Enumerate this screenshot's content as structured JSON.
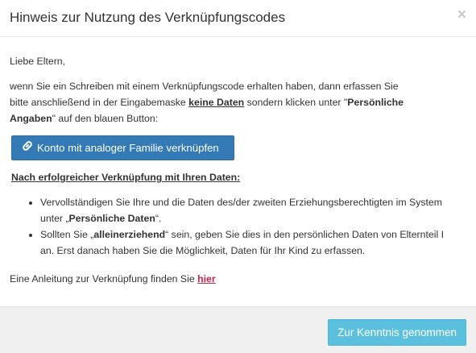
{
  "modal": {
    "title": "Hinweis zur Nutzung des Verknüpfungscodes",
    "close_symbol": "×"
  },
  "body": {
    "greeting": "Liebe Eltern,",
    "intro_line1": "wenn Sie ein Schreiben mit einem Verknüpfungscode erhalten haben, dann erfassen Sie",
    "intro_line2_a": "bitte anschließend in der Eingabemaske ",
    "intro_line2_bold": "keine Daten",
    "intro_line2_b": " sondern klicken unter \"",
    "intro_line2_bold2": "Persönliche",
    "intro_line3_bold": "Angaben",
    "intro_line3_b": "\" auf den blauen Button:",
    "link_button_label": "Konto mit analoger Familie verknüpfen",
    "after_heading": "Nach erfolgreicher Verknüpfung mit Ihren Daten:",
    "bullet1_line1": "Vervollständigen Sie Ihre und die Daten des/der zweiten Erziehungsberechtigten im System",
    "bullet1_line2_a": "unter „",
    "bullet1_line2_bold": "Persönliche Daten",
    "bullet1_line2_b": "“.",
    "bullet2_line1_a": "Sollten Sie „",
    "bullet2_line1_bold": "alleinerziehend",
    "bullet2_line1_b": "“ sein, geben Sie dies in den persönlichen Daten von Elternteil I",
    "bullet2_line2": "an. Erst danach haben Sie die Möglichkeit, Daten für Ihr Kind zu erfassen.",
    "guide_text": "Eine Anleitung zur Verknüpfung finden Sie ",
    "guide_link": "hier"
  },
  "footer": {
    "ack_button_label": "Zur Kenntnis genommen"
  },
  "icons": {
    "link_button_icon": "link-chain-icon",
    "close_icon": "close-icon"
  },
  "colors": {
    "primary_button": "#337ab7",
    "info_button": "#5bc0de",
    "link_text": "#c7254e",
    "footer_bg": "#f0f0f0"
  }
}
